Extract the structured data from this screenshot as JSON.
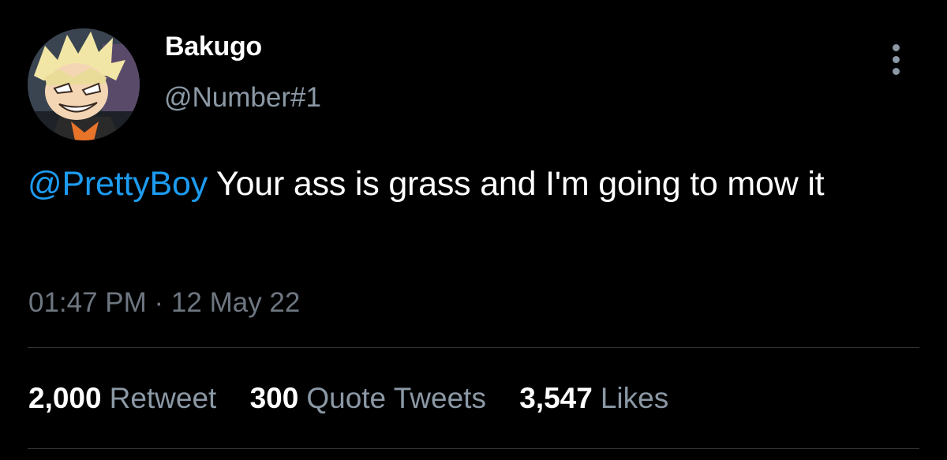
{
  "author": {
    "display_name": "Bakugo",
    "handle": "@Number#1",
    "avatar_icon": "anime-character-avatar"
  },
  "menu": {
    "icon": "more-vertical-icon"
  },
  "tweet": {
    "mention": "@PrettyBoy",
    "text": " Your ass is grass and I'm going to mow it",
    "time": "01:47 PM",
    "separator": " · ",
    "date": "12 May 22"
  },
  "stats": [
    {
      "count": "2,000",
      "label": "Retweet"
    },
    {
      "count": "300",
      "label": "Quote Tweets"
    },
    {
      "count": "3,547",
      "label": "Likes"
    }
  ],
  "colors": {
    "background": "#000000",
    "text": "#ffffff",
    "secondary_text": "#8b98a5",
    "link": "#1d9bf0",
    "divider": "#2f3336"
  }
}
